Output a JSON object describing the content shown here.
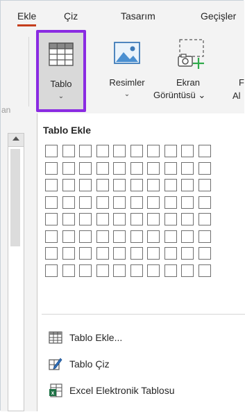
{
  "tabs": [
    {
      "label": "Ekle",
      "active": true
    },
    {
      "label": "Çiz"
    },
    {
      "label": "Tasarım"
    },
    {
      "label": "Geçişler"
    }
  ],
  "ribbon": {
    "left_cut_label": "an",
    "tablo": {
      "label": "Tablo",
      "chevron": "⌄"
    },
    "resimler": {
      "label": "Resimler",
      "chevron": "⌄"
    },
    "ekran": {
      "line1": "Ekran",
      "line2": "Görüntüsü ⌄"
    },
    "cut_top": "F",
    "cut_bottom": "Al"
  },
  "dropdown": {
    "title": "Tablo Ekle",
    "grid_cols": 10,
    "grid_rows": 8,
    "items": [
      {
        "label": "Tablo Ekle...",
        "icon": "table-grid-icon"
      },
      {
        "label": "Tablo Çiz",
        "icon": "draw-table-pencil-icon"
      },
      {
        "label": "Excel Elektronik Tablosu",
        "icon": "excel-sheet-icon"
      }
    ]
  },
  "colors": {
    "accent_underline": "#c43e1c",
    "selected_border": "#8a2be2",
    "excel_green": "#1e7145"
  }
}
